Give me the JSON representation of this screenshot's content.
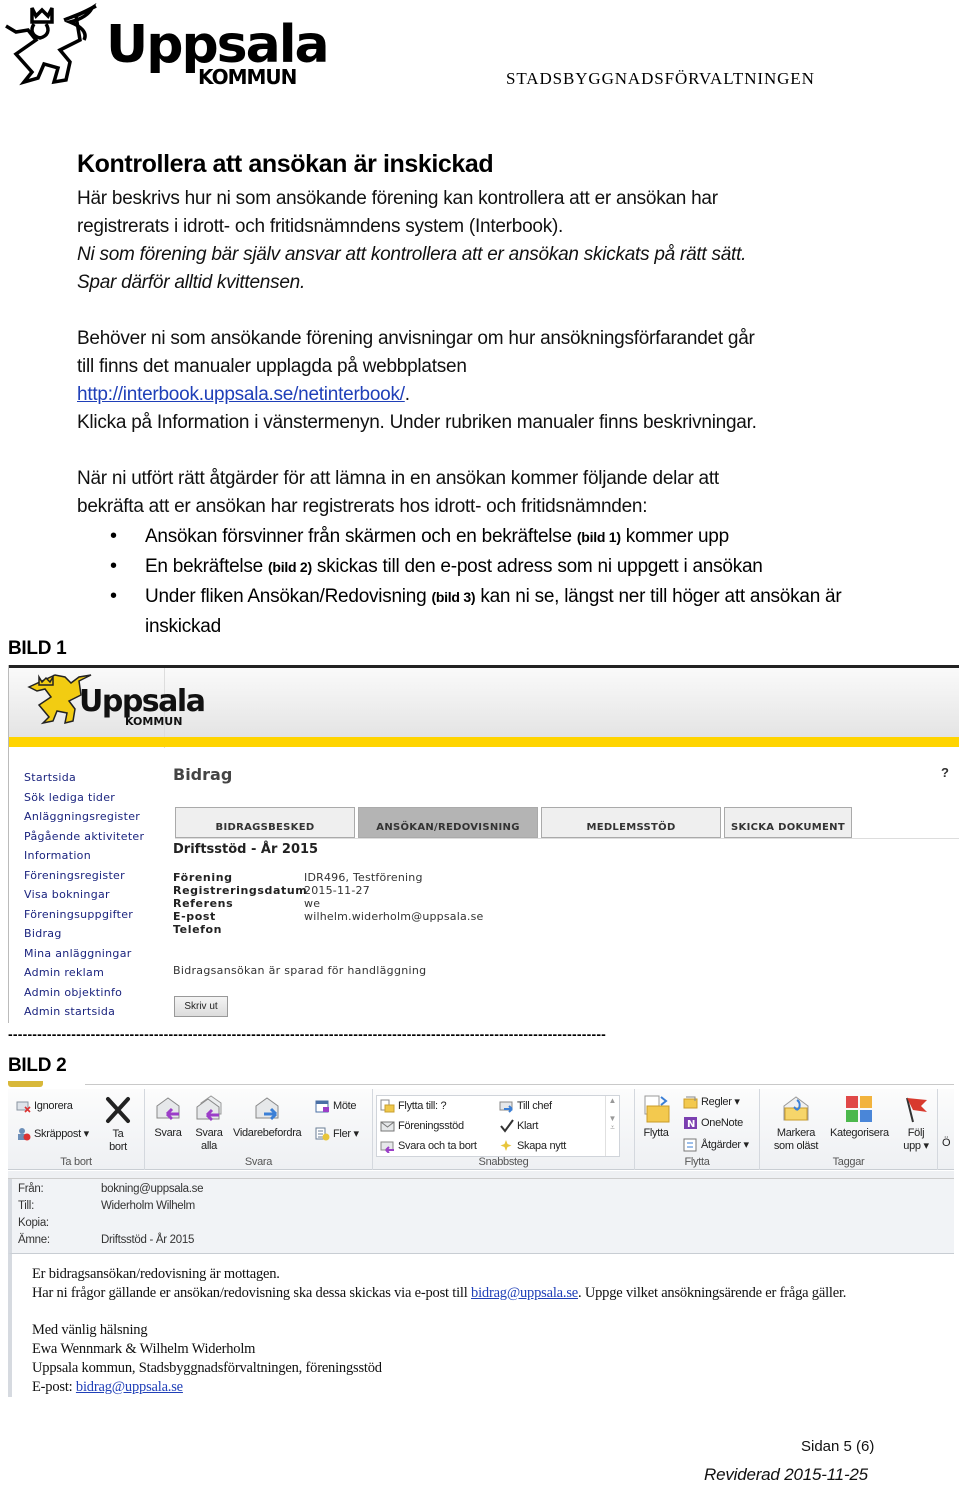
{
  "header": {
    "logo_text": "Uppsala",
    "logo_subtext": "KOMMUN",
    "department": "STADSBYGGNADSFÖRVALTNINGEN"
  },
  "document": {
    "title": "Kontrollera att ansökan är inskickad",
    "intro_lines": [
      "Här beskrivs hur ni som ansökande förening kan kontrollera att er ansökan har",
      "registrerats i idrott- och fritidsnämndens system (Interbook)."
    ],
    "italic_lines": [
      "Ni som förening bär själv ansvar att kontrollera att er ansökan skickats på rätt sätt.",
      "Spar därför alltid kvittensen."
    ],
    "manual_lines": [
      "Behöver ni som ansökande förening anvisningar om hur ansökningsförfarandet går",
      "till finns det manualer upplagda på webbplatsen"
    ],
    "manual_link": "http://interbook.uppsala.se/netinterbook/",
    "manual_link_suffix": ".",
    "manual_after": "Klicka på Information i vänstermenyn. Under rubriken manualer finns beskrivningar.",
    "confirm_lines": [
      "När ni utfört rätt åtgärder för att lämna in en ansökan kommer följande delar att",
      "bekräfta att er ansökan har registrerats hos idrott- och fritidsnämnden:"
    ],
    "bullets": [
      {
        "before": "Ansökan försvinner från skärmen och en bekräftelse ",
        "ref": "(bild 1)",
        "after": " kommer upp"
      },
      {
        "before": "En bekräftelse ",
        "ref": "(bild 2)",
        "after": " skickas till den e-post adress som ni uppgett i ansökan"
      },
      {
        "before": "Under fliken Ansökan/Redovisning ",
        "ref": "(bild 3)",
        "after": " kan ni se, längst ner till höger att ansökan är inskickad"
      }
    ],
    "bild1_label": "BILD 1",
    "bild2_label": "BILD 2",
    "separator": "---------------------------------------------------------------------------------------------------------------------------"
  },
  "bild1": {
    "logo_text": "Uppsala",
    "logo_subtext": "KOMMUN",
    "accent_color": "#ffd400",
    "nav": [
      "Startsida",
      "Sök lediga tider",
      "Anläggningsregister",
      "Pågående aktiviteter",
      "Information",
      "Föreningsregister",
      "Visa bokningar",
      "Föreningsuppgifter",
      "Bidrag",
      "Mina anläggningar",
      "Admin reklam",
      "Admin objektinfo",
      "Admin startsida"
    ],
    "heading": "Bidrag",
    "help": "?",
    "tabs": [
      {
        "label": "BIDRAGSBESKED",
        "active": false
      },
      {
        "label": "ANSÖKAN/REDOVISNING",
        "active": true
      },
      {
        "label": "MEDLEMSSTÖD",
        "active": false
      },
      {
        "label": "SKICKA DOKUMENT",
        "active": false
      }
    ],
    "subheading": "Driftsstöd - År 2015",
    "fields": [
      {
        "label": "Förening",
        "value": "IDR496, Testförening"
      },
      {
        "label": "Registreringsdatum",
        "value": "2015-11-27"
      },
      {
        "label": "Referens",
        "value": "we"
      },
      {
        "label": "E-post",
        "value": "wilhelm.widerholm@uppsala.se"
      },
      {
        "label": "Telefon",
        "value": ""
      }
    ],
    "status": "Bidragsansökan är sparad för handläggning",
    "print_button": "Skriv ut"
  },
  "bild2": {
    "ribbon_groups": [
      {
        "name": "Ta bort",
        "buttons": [
          "Ignorera",
          "Skräppost ▾",
          "Ta bort"
        ]
      },
      {
        "name": "Svara",
        "buttons": [
          "Svara",
          "Svara alla",
          "Vidarebefordra",
          "Möte",
          "Fler ▾"
        ]
      },
      {
        "name": "Snabbsteg",
        "buttons": [
          "Flytta till: ?",
          "Föreningsstöd",
          "Svara och ta bort",
          "Till chef",
          "Klart",
          "Skapa nytt"
        ]
      },
      {
        "name": "Flytta",
        "buttons": [
          "Flytta",
          "Regler ▾",
          "OneNote",
          "Åtgärder ▾"
        ]
      },
      {
        "name": "Taggar",
        "buttons": [
          "Markera som oläst",
          "Kategorisera",
          "Följ upp ▾"
        ]
      }
    ],
    "ribbon_overflow": "Ö",
    "headers": [
      {
        "label": "Från:",
        "value": "bokning@uppsala.se"
      },
      {
        "label": "Till:",
        "value": "Widerholm Wilhelm"
      },
      {
        "label": "Kopia:",
        "value": ""
      },
      {
        "label": "Ämne:",
        "value": "Driftsstöd  - År 2015"
      }
    ],
    "body": {
      "line1": "Er bidragsansökan/redovisning är mottagen.",
      "line2_before": "Har ni frågor gällande er ansökan/redovisning ska dessa skickas via e-post till ",
      "line2_link": "bidrag@uppsala.se",
      "line2_after": ". Uppge vilket ansökningsärende er fråga gäller.",
      "greeting": "Med vänlig hälsning",
      "names": "Ewa Wennmark & Wilhelm Widerholm",
      "org": "Uppsala kommun, Stadsbyggnadsförvaltningen, föreningsstöd",
      "email_label": "E-post: ",
      "email_link": "bidrag@uppsala.se"
    }
  },
  "footer": {
    "page": "Sidan 5 (6)",
    "revised": "Reviderad 2015-11-25"
  }
}
